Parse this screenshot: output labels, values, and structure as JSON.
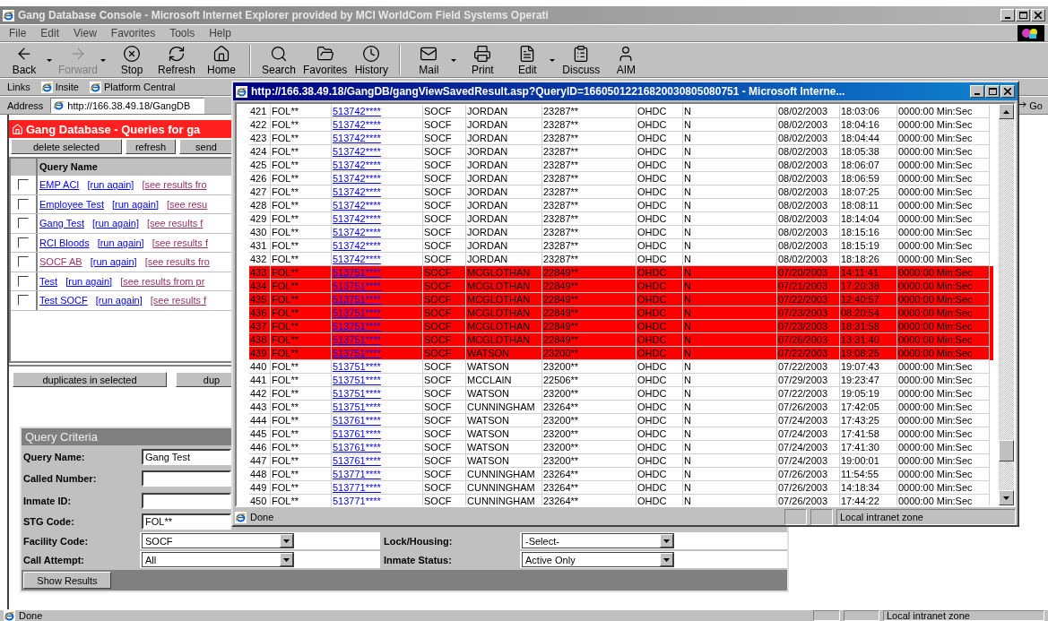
{
  "window": {
    "title": "Gang Database Console - Microsoft Internet Explorer provided by MCI WorldCom Field Systems Operati"
  },
  "menu": [
    "File",
    "Edit",
    "View",
    "Favorites",
    "Tools",
    "Help"
  ],
  "toolbar": [
    [
      {
        "label": "Back",
        "kind": "back",
        "disabled": false,
        "dropdown": true
      },
      {
        "label": "Forward",
        "kind": "forward",
        "disabled": true,
        "dropdown": true
      },
      {
        "label": "Stop",
        "kind": "stop",
        "disabled": false,
        "dropdown": false
      },
      {
        "label": "Refresh",
        "kind": "refresh",
        "disabled": false,
        "dropdown": false
      },
      {
        "label": "Home",
        "kind": "home",
        "disabled": false,
        "dropdown": false
      }
    ],
    [
      {
        "label": "Search",
        "kind": "search",
        "disabled": false,
        "dropdown": false
      },
      {
        "label": "Favorites",
        "kind": "favorites",
        "disabled": false,
        "dropdown": false
      },
      {
        "label": "History",
        "kind": "history",
        "disabled": false,
        "dropdown": false
      }
    ],
    [
      {
        "label": "Mail",
        "kind": "mail",
        "disabled": false,
        "dropdown": true
      },
      {
        "label": "Print",
        "kind": "print",
        "disabled": false,
        "dropdown": false
      },
      {
        "label": "Edit",
        "kind": "edit",
        "disabled": false,
        "dropdown": true
      },
      {
        "label": "Discuss",
        "kind": "discuss",
        "disabled": false,
        "dropdown": false
      },
      {
        "label": "AIM",
        "kind": "aim",
        "disabled": false,
        "dropdown": false
      }
    ]
  ],
  "links": {
    "label": "Links",
    "items": [
      "Insite",
      "Platform Central"
    ]
  },
  "address": {
    "label": "Address",
    "value": "http://166.38.49.18/GangDB",
    "go": "Go"
  },
  "left_panel": {
    "title": "Gang Database - Queries for ga",
    "buttons": [
      "delete selected",
      "refresh",
      "send"
    ],
    "column": "Query Name",
    "queries": [
      {
        "name": "EMP ACI",
        "visited": false,
        "checked": false,
        "run": "[run again]",
        "see": "[see results fro"
      },
      {
        "name": "Employee Test",
        "visited": false,
        "checked": false,
        "run": "[run again]",
        "see": "[see resu"
      },
      {
        "name": "Gang Test",
        "visited": false,
        "checked": false,
        "run": "[run again]",
        "see": "[see results f"
      },
      {
        "name": "RCI Bloods",
        "visited": false,
        "checked": false,
        "run": "[run again]",
        "see": "[see results f"
      },
      {
        "name": "SOCF AB",
        "visited": true,
        "checked": false,
        "run": "[run again]",
        "see": "[see results fro"
      },
      {
        "name": "Test",
        "visited": false,
        "checked": false,
        "run": "[run again]",
        "see": "[see results from pr"
      },
      {
        "name": "Test SOCF",
        "visited": false,
        "checked": false,
        "run": "[run again]",
        "see": "[see results f"
      }
    ],
    "bottom_buttons": [
      "duplicates in selected",
      "dup"
    ]
  },
  "criteria": {
    "title": "Query Criteria",
    "rows": [
      [
        {
          "label": "Query Name:",
          "kind": "text",
          "value": "Gang Test"
        }
      ],
      [
        {
          "label": "Called Number:",
          "kind": "text"
        }
      ],
      [
        {
          "label": "Inmate ID:",
          "kind": "text"
        }
      ],
      [
        {
          "label": "STG Code:",
          "kind": "text",
          "value": "FOL**"
        }
      ],
      [
        {
          "label": "Facility Code:",
          "kind": "select",
          "value": "SOCF"
        },
        {
          "label": "Lock/Housing:",
          "kind": "select",
          "value": "-Select-"
        }
      ],
      [
        {
          "label": "Call Attempt:",
          "kind": "select",
          "value": "All"
        },
        {
          "label": "Inmate Status:",
          "kind": "select",
          "value": "Active Only"
        }
      ]
    ],
    "button": "Show Results"
  },
  "popup": {
    "title": "http://166.38.49.18/GangDB/gangViewSavedResult.asp?QueryID=16605012216820030805080751 - Microsoft Interne...",
    "rows": [
      {
        "highlighted": false,
        "cells": [
          "421",
          "FOL**",
          "513742****",
          "SOCF",
          "JORDAN",
          "23287**",
          "OHDC",
          "N",
          "08/02/2003",
          "18:03:06",
          "0000:00 Min:Sec"
        ]
      },
      {
        "highlighted": false,
        "cells": [
          "422",
          "FOL**",
          "513742****",
          "SOCF",
          "JORDAN",
          "23287**",
          "OHDC",
          "N",
          "08/02/2003",
          "18:04:16",
          "0000:00 Min:Sec"
        ]
      },
      {
        "highlighted": false,
        "cells": [
          "423",
          "FOL**",
          "513742****",
          "SOCF",
          "JORDAN",
          "23287**",
          "OHDC",
          "N",
          "08/02/2003",
          "18:04:44",
          "0000:00 Min:Sec"
        ]
      },
      {
        "highlighted": false,
        "cells": [
          "424",
          "FOL**",
          "513742****",
          "SOCF",
          "JORDAN",
          "23287**",
          "OHDC",
          "N",
          "08/02/2003",
          "18:05:38",
          "0000:00 Min:Sec"
        ]
      },
      {
        "highlighted": false,
        "cells": [
          "425",
          "FOL**",
          "513742****",
          "SOCF",
          "JORDAN",
          "23287**",
          "OHDC",
          "N",
          "08/02/2003",
          "18:06:07",
          "0000:00 Min:Sec"
        ]
      },
      {
        "highlighted": false,
        "cells": [
          "426",
          "FOL**",
          "513742****",
          "SOCF",
          "JORDAN",
          "23287**",
          "OHDC",
          "N",
          "08/02/2003",
          "18:06:59",
          "0000:00 Min:Sec"
        ]
      },
      {
        "highlighted": false,
        "cells": [
          "427",
          "FOL**",
          "513742****",
          "SOCF",
          "JORDAN",
          "23287**",
          "OHDC",
          "N",
          "08/02/2003",
          "18:07:25",
          "0000:00 Min:Sec"
        ]
      },
      {
        "highlighted": false,
        "cells": [
          "428",
          "FOL**",
          "513742****",
          "SOCF",
          "JORDAN",
          "23287**",
          "OHDC",
          "N",
          "08/02/2003",
          "18:08:11",
          "0000:00 Min:Sec"
        ]
      },
      {
        "highlighted": false,
        "cells": [
          "429",
          "FOL**",
          "513742****",
          "SOCF",
          "JORDAN",
          "23287**",
          "OHDC",
          "N",
          "08/02/2003",
          "18:14:04",
          "0000:00 Min:Sec"
        ]
      },
      {
        "highlighted": false,
        "cells": [
          "430",
          "FOL**",
          "513742****",
          "SOCF",
          "JORDAN",
          "23287**",
          "OHDC",
          "N",
          "08/02/2003",
          "18:15:16",
          "0000:00 Min:Sec"
        ]
      },
      {
        "highlighted": false,
        "cells": [
          "431",
          "FOL**",
          "513742****",
          "SOCF",
          "JORDAN",
          "23287**",
          "OHDC",
          "N",
          "08/02/2003",
          "18:15:19",
          "0000:00 Min:Sec"
        ]
      },
      {
        "highlighted": false,
        "cells": [
          "432",
          "FOL**",
          "513742****",
          "SOCF",
          "JORDAN",
          "23287**",
          "OHDC",
          "N",
          "08/02/2003",
          "18:18:26",
          "0000:00 Min:Sec"
        ]
      },
      {
        "highlighted": true,
        "cells": [
          "433",
          "FOL**",
          "513751****",
          "SOCF",
          "MCGLOTHAN",
          "22849**",
          "OHDC",
          "N",
          "07/20/2003",
          "14:11:41",
          "0000:00 Min:Sec"
        ]
      },
      {
        "highlighted": true,
        "cells": [
          "434",
          "FOL**",
          "513751****",
          "SOCF",
          "MCGLOTHAN",
          "22849**",
          "OHDC",
          "N",
          "07/21/2003",
          "17:20:38",
          "0000:00 Min:Sec"
        ]
      },
      {
        "highlighted": true,
        "cells": [
          "435",
          "FOL**",
          "513751****",
          "SOCF",
          "MCGLOTHAN",
          "22849**",
          "OHDC",
          "N",
          "07/22/2003",
          "12:40:57",
          "0000:00 Min:Sec"
        ]
      },
      {
        "highlighted": true,
        "cells": [
          "436",
          "FOL**",
          "513751****",
          "SOCF",
          "MCGLOTHAN",
          "22849**",
          "OHDC",
          "N",
          "07/23/2003",
          "08:20:54",
          "0000:00 Min:Sec"
        ]
      },
      {
        "highlighted": true,
        "cells": [
          "437",
          "FOL**",
          "513751****",
          "SOCF",
          "MCGLOTHAN",
          "22849**",
          "OHDC",
          "N",
          "07/23/2003",
          "18:31:58",
          "0000:00 Min:Sec"
        ]
      },
      {
        "highlighted": true,
        "cells": [
          "438",
          "FOL**",
          "513751****",
          "SOCF",
          "MCGLOTHAN",
          "22849**",
          "OHDC",
          "N",
          "07/26/2003",
          "13:31:40",
          "0000:00 Min:Sec"
        ]
      },
      {
        "highlighted": true,
        "cells": [
          "439",
          "FOL**",
          "513751****",
          "SOCF",
          "WATSON",
          "23200**",
          "OHDC",
          "N",
          "07/22/2003",
          "19:08:25",
          "0000:00 Min:Sec"
        ]
      },
      {
        "highlighted": false,
        "cells": [
          "440",
          "FOL**",
          "513751****",
          "SOCF",
          "WATSON",
          "23200**",
          "OHDC",
          "N",
          "07/22/2003",
          "19:07:43",
          "0000:00 Min:Sec"
        ]
      },
      {
        "highlighted": false,
        "cells": [
          "441",
          "FOL**",
          "513751****",
          "SOCF",
          "MCCLAIN",
          "22506**",
          "OHDC",
          "N",
          "07/29/2003",
          "19:23:47",
          "0000:00 Min:Sec"
        ]
      },
      {
        "highlighted": false,
        "cells": [
          "442",
          "FOL**",
          "513751****",
          "SOCF",
          "WATSON",
          "23200**",
          "OHDC",
          "N",
          "07/22/2003",
          "19:05:19",
          "0000:00 Min:Sec"
        ]
      },
      {
        "highlighted": false,
        "cells": [
          "443",
          "FOL**",
          "513751****",
          "SOCF",
          "CUNNINGHAM",
          "23264**",
          "OHDC",
          "N",
          "07/26/2003",
          "17:42:05",
          "0000:00 Min:Sec"
        ]
      },
      {
        "highlighted": false,
        "cells": [
          "444",
          "FOL**",
          "513761****",
          "SOCF",
          "WATSON",
          "23200**",
          "OHDC",
          "N",
          "07/24/2003",
          "17:43:25",
          "0000:00 Min:Sec"
        ]
      },
      {
        "highlighted": false,
        "cells": [
          "445",
          "FOL**",
          "513761****",
          "SOCF",
          "WATSON",
          "23200**",
          "OHDC",
          "N",
          "07/24/2003",
          "17:41:58",
          "0000:00 Min:Sec"
        ]
      },
      {
        "highlighted": false,
        "cells": [
          "446",
          "FOL**",
          "513761****",
          "SOCF",
          "WATSON",
          "23200**",
          "OHDC",
          "N",
          "07/24/2003",
          "17:41:30",
          "0000:00 Min:Sec"
        ]
      },
      {
        "highlighted": false,
        "cells": [
          "447",
          "FOL**",
          "513761****",
          "SOCF",
          "WATSON",
          "23200**",
          "OHDC",
          "N",
          "07/24/2003",
          "19:00:01",
          "0000:00 Min:Sec"
        ]
      },
      {
        "highlighted": false,
        "cells": [
          "448",
          "FOL**",
          "513771****",
          "SOCF",
          "CUNNINGHAM",
          "23264**",
          "OHDC",
          "N",
          "07/26/2003",
          "11:54:55",
          "0000:00 Min:Sec"
        ]
      },
      {
        "highlighted": false,
        "cells": [
          "449",
          "FOL**",
          "513771****",
          "SOCF",
          "CUNNINGHAM",
          "23264**",
          "OHDC",
          "N",
          "07/26/2003",
          "14:18:34",
          "0000:00 Min:Sec"
        ]
      },
      {
        "highlighted": false,
        "cells": [
          "450",
          "FOL**",
          "513771****",
          "SOCF",
          "CUNNINGHAM",
          "23264**",
          "OHDC",
          "N",
          "07/26/2003",
          "17:44:22",
          "0000:00 Min:Sec"
        ]
      }
    ],
    "status": "Done",
    "zone": "Local intranet zone"
  },
  "status_bar": {
    "text": "Done",
    "zone": "Local intranet zone"
  }
}
